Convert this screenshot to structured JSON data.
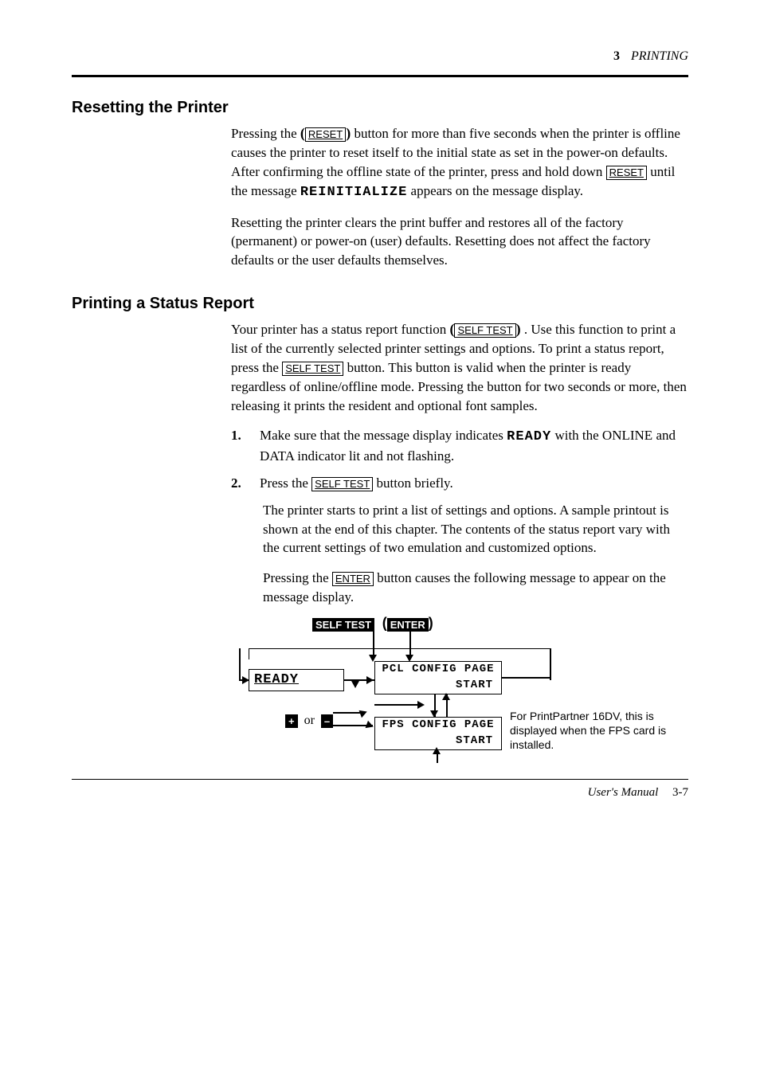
{
  "header": {
    "chapter_num": "3",
    "chapter_title": "PRINTING"
  },
  "sections": {
    "reset": {
      "title": "Resetting the Printer",
      "btn_label": "RESET",
      "btn_label2": "RESET",
      "para1_a": "Pressing the ",
      "para1_b": " button for more than five seconds when the printer is offline causes the printer to reset itself to the initial state as set in the power-on defaults. After confirming the offline state of the printer, press and hold down ",
      "para1_c": " until the message ",
      "reinit": "REINITIALIZE",
      "para1_d": " appears on the message display.",
      "para2": "Resetting the printer clears the print buffer and restores all of the factory (permanent) or power-on (user) defaults. Resetting does not affect the factory defaults or the user defaults themselves."
    },
    "status": {
      "title": "Printing a Status Report",
      "btn_self1": "SELF TEST",
      "btn_self2": "SELF TEST",
      "btn_self3": "SELF TEST",
      "btn_enter": "ENTER",
      "para1_a": "Your printer has a status report function ",
      "para1_b": ". Use this function to print a list of the currently selected printer settings and options. To print a status report, press the ",
      "para1_c": " button. This button is valid when the printer is ready regardless of online/offline mode. Pressing the button for two seconds or more, then releasing it prints the resident and optional font samples.",
      "para2": "The printer starts to print a list of settings and options. A sample printout is shown at the end of this chapter. The contents of the status report vary with the current settings of two emulation and customized options.",
      "para3_a": "Pressing the ",
      "para3_b": " button causes the following message to appear on the message display.",
      "step1_num": "1.",
      "step1_body_a": "Make sure that the message display indicates ",
      "step1_ready": "READY",
      "step1_body_b": " with the ONLINE and DATA indicator lit and not flashing.",
      "step2_num": "2.",
      "step2_body_a": "Press the ",
      "step2_body_b": " button briefly."
    },
    "diagram": {
      "selftest_key": "SELF TEST",
      "enter_key": "ENTER",
      "ready": "READY",
      "pcl_line1": "PCL CONFIG PAGE",
      "pcl_line2": "START",
      "fps_line1": "FPS CONFIG PAGE",
      "fps_line2": "START",
      "plus": "+",
      "minus": "–",
      "or": "or",
      "note": "For PrintPartner 16DV, this is displayed when the FPS card is installed."
    }
  },
  "footer": {
    "label": "User's Manual",
    "page": "3-7"
  }
}
